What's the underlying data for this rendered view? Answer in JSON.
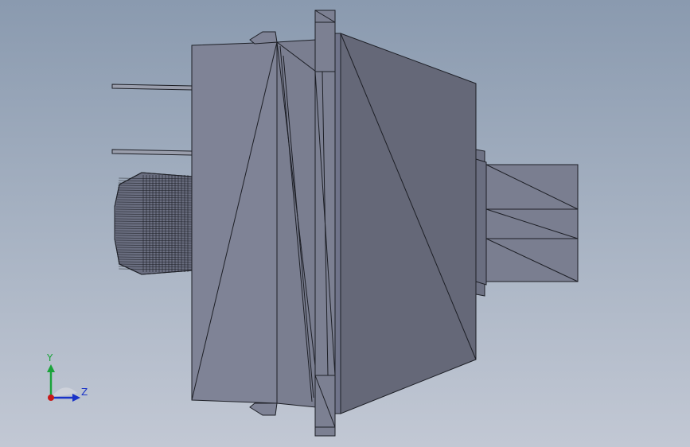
{
  "viewport": {
    "background_top": "#8a9aaf",
    "background_bottom": "#c2c8d4"
  },
  "model": {
    "colors": {
      "body_light": "#7f8396",
      "body_mid": "#747889",
      "cone": "#656878",
      "flange": "#7c8092",
      "shaft": "#7a7e90",
      "pin": "#9a9eac",
      "thread_bg": "#6a6e80",
      "edge": "#1d1f26"
    }
  },
  "triad": {
    "y_label": "Y",
    "z_label": "Z",
    "y_color": "#1aa33a",
    "z_color": "#1a33c8",
    "x_color": "#c81a1a",
    "icon": "coordinate-triad-icon"
  }
}
